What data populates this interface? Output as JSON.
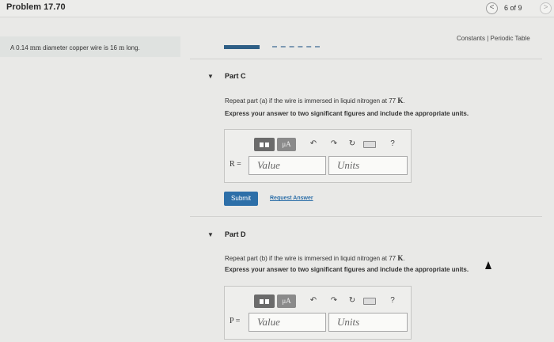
{
  "header": {
    "title": "Problem 17.70",
    "prev_icon": "<",
    "next_icon": ">",
    "page_count": "6 of 9"
  },
  "problem": {
    "text_prefix": "A 0.14 ",
    "unit_mm": "mm",
    "text_middle": " diameter copper wire is 16 ",
    "unit_m": "m",
    "text_suffix": " long."
  },
  "links": {
    "constants": "Constants | Periodic Table"
  },
  "parts": [
    {
      "label": "Part C",
      "question_prefix": "Repeat part (a) if the wire is immersed in liquid nitrogen at 77 ",
      "question_unit": "K",
      "question_suffix": ".",
      "instruction": "Express your answer to two significant figures and include the appropriate units.",
      "variable": "R =",
      "value_placeholder": "Value",
      "units_placeholder": "Units"
    },
    {
      "label": "Part D",
      "question_prefix": "Repeat part (b) if the wire is immersed in liquid nitrogen at 77 ",
      "question_unit": "K",
      "question_suffix": ".",
      "instruction": "Express your answer to two significant figures and include the appropriate units.",
      "variable": "P =",
      "value_placeholder": "Value",
      "units_placeholder": "Units"
    }
  ],
  "toolbar": {
    "units_label": "μA",
    "undo_icon": "↶",
    "redo_icon": "↷",
    "reset_icon": "↻",
    "help_icon": "?"
  },
  "actions": {
    "submit": "Submit",
    "request_answer": "Request Answer"
  }
}
